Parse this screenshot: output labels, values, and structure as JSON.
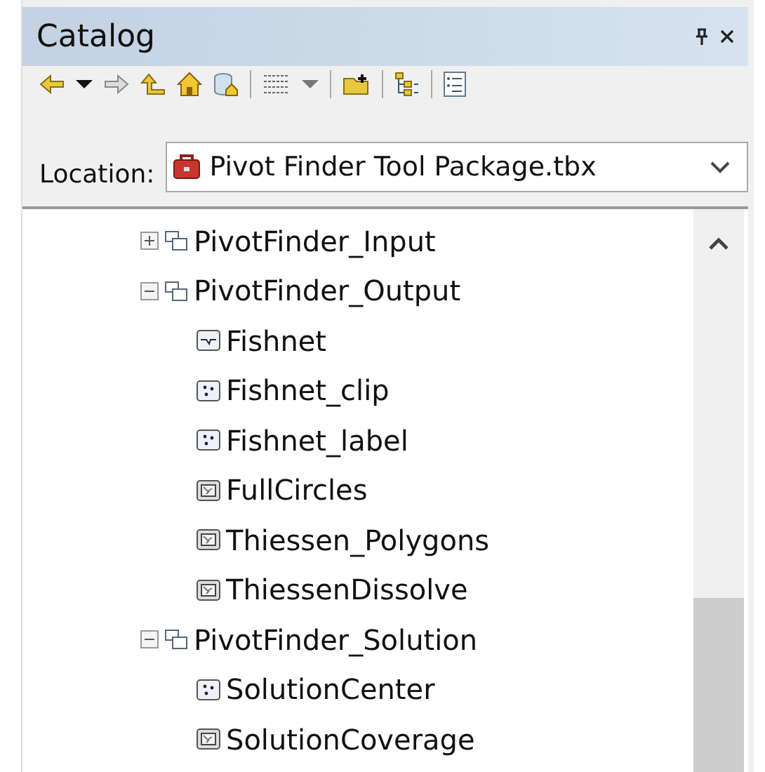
{
  "panel": {
    "title": "Catalog"
  },
  "location": {
    "label": "Location:",
    "value": "Pivot Finder Tool Package.tbx"
  },
  "tree": [
    {
      "label": "PivotFinder_Input",
      "kind": "group",
      "expanded": false
    },
    {
      "label": "PivotFinder_Output",
      "kind": "group",
      "expanded": true,
      "children": [
        {
          "label": "Fishnet",
          "kind": "line"
        },
        {
          "label": "Fishnet_clip",
          "kind": "point"
        },
        {
          "label": "Fishnet_label",
          "kind": "point"
        },
        {
          "label": "FullCircles",
          "kind": "polygon"
        },
        {
          "label": "Thiessen_Polygons",
          "kind": "polygon"
        },
        {
          "label": "ThiessenDissolve",
          "kind": "polygon"
        }
      ]
    },
    {
      "label": "PivotFinder_Solution",
      "kind": "group",
      "expanded": true,
      "children": [
        {
          "label": "SolutionCenter",
          "kind": "point"
        },
        {
          "label": "SolutionCoverage",
          "kind": "polygon"
        }
      ]
    }
  ]
}
